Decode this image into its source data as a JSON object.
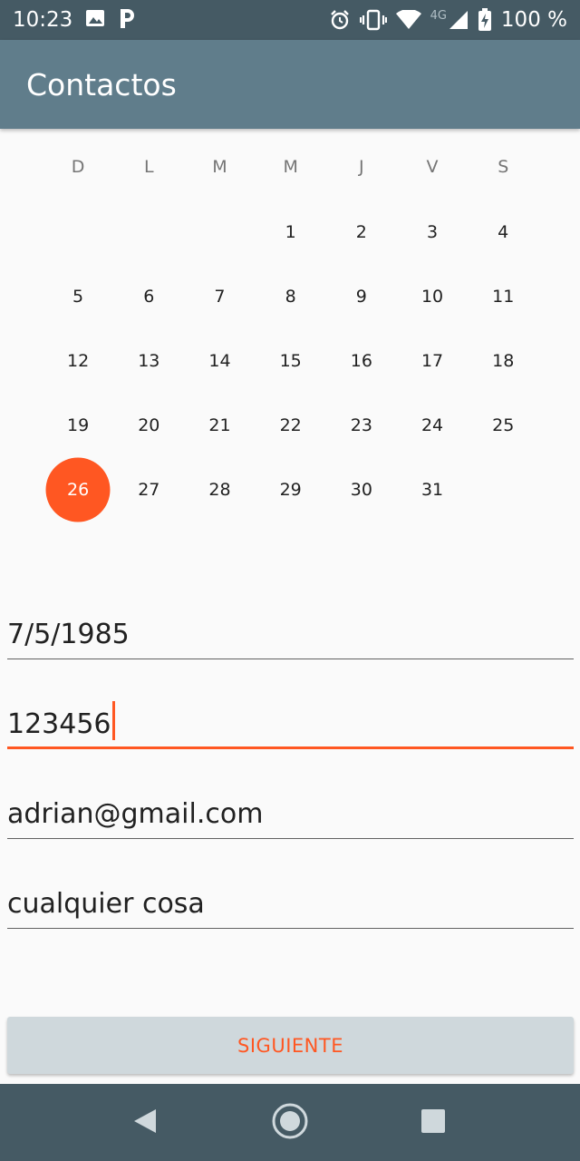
{
  "status_bar": {
    "time": "10:23",
    "network": "4G",
    "battery": "100 %",
    "icons": [
      "image-icon",
      "parking-icon",
      "alarm-icon",
      "vibrate-icon",
      "wifi-icon",
      "signal-icon",
      "battery-charging-icon"
    ]
  },
  "app_bar": {
    "title": "Contactos"
  },
  "calendar": {
    "weekdays": [
      "D",
      "L",
      "M",
      "M",
      "J",
      "V",
      "S"
    ],
    "weeks": [
      [
        "",
        "",
        "",
        "1",
        "2",
        "3",
        "4"
      ],
      [
        "5",
        "6",
        "7",
        "8",
        "9",
        "10",
        "11"
      ],
      [
        "12",
        "13",
        "14",
        "15",
        "16",
        "17",
        "18"
      ],
      [
        "19",
        "20",
        "21",
        "22",
        "23",
        "24",
        "25"
      ],
      [
        "26",
        "27",
        "28",
        "29",
        "30",
        "31",
        ""
      ]
    ],
    "selected_day": "26"
  },
  "form": {
    "birthdate_value": "7/5/1985",
    "phone_value": "123456",
    "email_value": "adrian@gmail.com",
    "description_value": "cualquier cosa"
  },
  "button": {
    "next_label": "SIGUIENTE"
  },
  "nav_bar": {
    "icons": [
      "back-icon",
      "home-icon",
      "recents-icon"
    ]
  },
  "colors": {
    "accent": "#ff5722",
    "app_bar": "#607d8b",
    "status_bar": "#455a64"
  }
}
